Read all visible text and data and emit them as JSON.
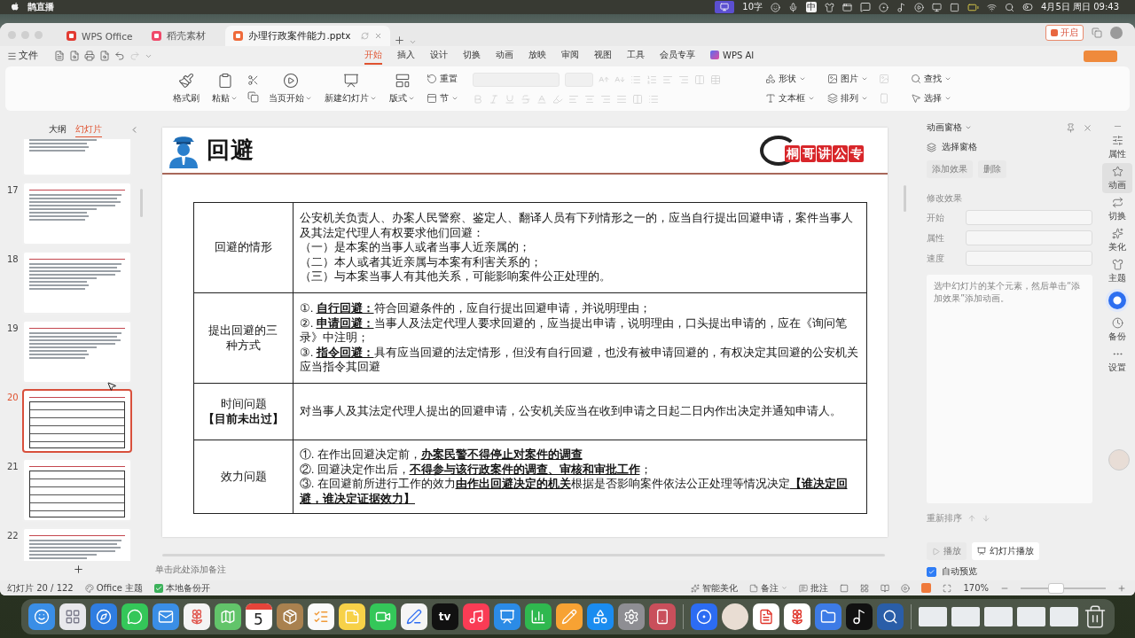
{
  "menu_bar": {
    "app_name": "鹊直播",
    "word_count": "10字",
    "input_method": "中",
    "clock": "4月5日 周日 09:43"
  },
  "tabs": [
    {
      "label": "WPS Office",
      "selected": false
    },
    {
      "label": "稻壳素材",
      "selected": false
    },
    {
      "label": "办理行政案件能力.pptx",
      "selected": true
    }
  ],
  "trial_button": "开启",
  "file_menu": "文件",
  "ribbon_tabs": [
    {
      "label": "开始",
      "selected": true
    },
    {
      "label": "插入",
      "selected": false
    },
    {
      "label": "设计",
      "selected": false
    },
    {
      "label": "切换",
      "selected": false
    },
    {
      "label": "动画",
      "selected": false
    },
    {
      "label": "放映",
      "selected": false
    },
    {
      "label": "审阅",
      "selected": false
    },
    {
      "label": "视图",
      "selected": false
    },
    {
      "label": "工具",
      "selected": false
    },
    {
      "label": "会员专享",
      "selected": false
    },
    {
      "label": "WPS AI",
      "selected": false
    }
  ],
  "toolbar": {
    "large": [
      {
        "label": "格式刷",
        "menu": false
      },
      {
        "label": "粘贴",
        "menu": true
      },
      {
        "label": "当页开始",
        "menu": true
      },
      {
        "label": "新建幻灯片",
        "menu": true
      },
      {
        "label": "版式",
        "menu": true
      }
    ],
    "small": [
      {
        "label": "重置",
        "menu": false
      },
      {
        "label": "节",
        "menu": true
      }
    ],
    "formatting_disabled": true,
    "insert": [
      {
        "label": "形状",
        "menu": true
      },
      {
        "label": "图片",
        "menu": true
      },
      {
        "label": "文本框",
        "menu": true
      },
      {
        "label": "排列",
        "menu": true
      }
    ],
    "edit": [
      {
        "label": "查找",
        "menu": true
      },
      {
        "label": "选择",
        "menu": true
      }
    ]
  },
  "outline": {
    "tabs": [
      {
        "label": "大纲",
        "selected": false
      },
      {
        "label": "幻灯片",
        "selected": true
      }
    ],
    "thumbnails": [
      {
        "kind": "text",
        "selected": false
      },
      {
        "number": "17",
        "kind": "text",
        "selected": false
      },
      {
        "number": "18",
        "kind": "text",
        "selected": false
      },
      {
        "number": "19",
        "kind": "text",
        "selected": false
      },
      {
        "number": "20",
        "kind": "table",
        "selected": true
      },
      {
        "number": "21",
        "kind": "table",
        "selected": false
      },
      {
        "number": "22",
        "kind": "text",
        "selected": false
      }
    ]
  },
  "slide": {
    "title": "回避",
    "logo": "桐哥讲公专",
    "rows": [
      {
        "heading": [
          "回避的情形"
        ],
        "lines": [
          "公安机关负责人、办案人民警察、鉴定人、翻译人员有下列情形之一的，应当自行提出回避申请，案件当事人及其法定代理人有权要求他们回避：",
          "（一）是本案的当事人或者当事人近亲属的；",
          "（二）本人或者其近亲属与本案有利害关系的；",
          "（三）与本案当事人有其他关系，可能影响案件公正处理的。"
        ]
      },
      {
        "heading": [
          "提出回避的三种方式"
        ],
        "lines": [
          "①. **自行回避：**符合回避条件的，应自行提出回避申请，并说明理由；",
          "②. **申请回避：**当事人及法定代理人要求回避的，应当提出申请，说明理由，口头提出申请的，应在《询问笔录》中注明；",
          "③. **指令回避：**具有应当回避的法定情形，但没有自行回避，也没有被申请回避的，有权决定其回避的公安机关应当指令其回避"
        ]
      },
      {
        "heading": [
          "时间问题",
          "**【目前未出过】**"
        ],
        "lines": [
          "对当事人及其法定代理人提出的回避申请，公安机关应当在收到申请之日起二日内作出决定并通知申请人。"
        ]
      },
      {
        "heading": [
          "效力问题"
        ],
        "lines": [
          "①. 在作出回避决定前，**办案民警不得停止对案件的调查**",
          "②. 回避决定作出后，**不得参与该行政案件的调查、审核和审批工作**；",
          "③. 在回避前所进行工作的效力**由作出回避决定的机关**根据是否影响案件依法公正处理等情况决定**【谁决定回避，谁决定证据效力】**"
        ]
      }
    ]
  },
  "notes": {
    "placeholder": "单击此处添加备注"
  },
  "animation_pane": {
    "title": "动画窗格",
    "select_pane": "选择窗格",
    "buttons": [
      {
        "label": "添加效果",
        "disabled": true
      },
      {
        "label": "删除",
        "disabled": true
      }
    ],
    "section": "修改效果",
    "fields": [
      {
        "label": "开始",
        "disabled": true
      },
      {
        "label": "属性",
        "disabled": true
      },
      {
        "label": "速度",
        "disabled": true
      }
    ],
    "hint": "选中幻灯片的某个元素，然后单击“添加效果”添加动画。",
    "reorder": "重新排序",
    "play": {
      "label": "播放",
      "disabled": true
    },
    "slideshow": "幻灯片播放",
    "auto_preview": {
      "label": "自动预览",
      "checked": true
    }
  },
  "side_strip": [
    {
      "kind": "tool",
      "label": "属性",
      "selected": false
    },
    {
      "kind": "tool",
      "label": "动画",
      "selected": true
    },
    {
      "kind": "tool",
      "label": "切换",
      "selected": false
    },
    {
      "kind": "tool",
      "label": "美化",
      "selected": false
    },
    {
      "kind": "tool",
      "label": "主题",
      "selected": false
    },
    {
      "kind": "assistant",
      "selected": false
    },
    {
      "kind": "tool",
      "label": "备份",
      "selected": false
    },
    {
      "kind": "tool",
      "label": "设置",
      "selected": false
    }
  ],
  "status_bar": {
    "slide_counter": "幻灯片 20 / 122",
    "theme": "Office 主题",
    "backup": "本地备份开",
    "beautify": "智能美化",
    "notes": "备注",
    "comments": "批注",
    "zoom": "170%",
    "zoom_slider": {
      "level": 0.42
    }
  },
  "dock": {
    "calendar_day": "5",
    "tv_label": "tv"
  }
}
